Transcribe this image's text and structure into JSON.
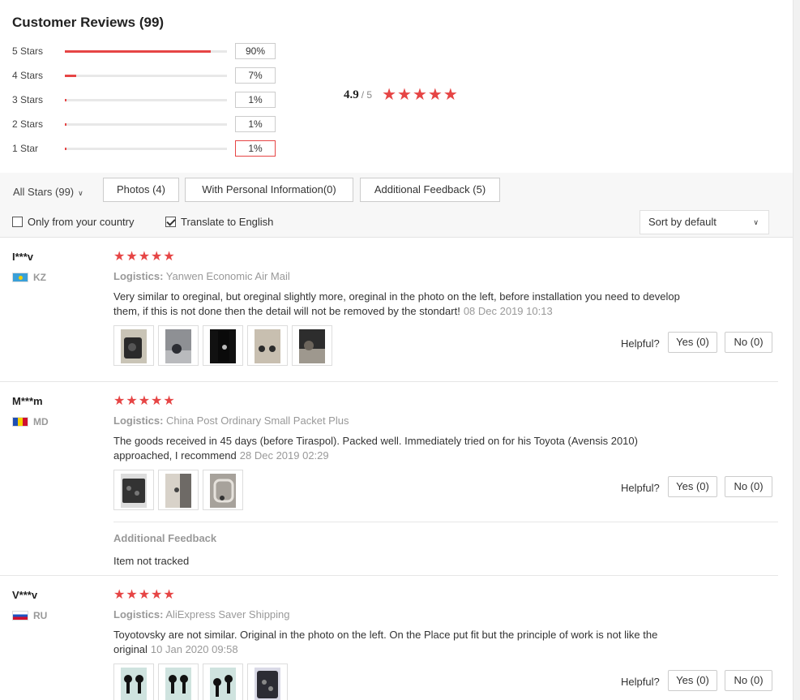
{
  "title": "Customer Reviews (99)",
  "histogram": [
    {
      "label": "5 Stars",
      "percent": "90%",
      "fraction": 0.9
    },
    {
      "label": "4 Stars",
      "percent": "7%",
      "fraction": 0.07
    },
    {
      "label": "3 Stars",
      "percent": "1%",
      "fraction": 0.01
    },
    {
      "label": "2 Stars",
      "percent": "1%",
      "fraction": 0.01
    },
    {
      "label": "1 Star",
      "percent": "1%",
      "fraction": 0.01
    }
  ],
  "average": {
    "score": "4.9",
    "out_of": "/ 5",
    "stars": 5
  },
  "filters": {
    "all_stars": "All Stars (99)",
    "photos": "Photos (4)",
    "personal_info": "With Personal Information(0)",
    "additional_feedback": "Additional Feedback (5)",
    "only_country": "Only from your country",
    "translate": "Translate to English",
    "sort": "Sort by default"
  },
  "helpful_label": "Helpful?",
  "yes_label": "Yes (0)",
  "no_label": "No (0)",
  "logistics_prefix": "Logistics:",
  "reviews": [
    {
      "user": "I***v",
      "country": "KZ",
      "stars": 5,
      "logistics": "Yanwen Economic Air Mail",
      "text": "Very similar to oreginal, but oreginal slightly more, oreginal in the photo on the left, before installation you need to develop them, if this is not done then the detail will not be removed by the stondart!",
      "date": "08 Dec 2019 10:13"
    },
    {
      "user": "M***m",
      "country": "MD",
      "stars": 5,
      "logistics": "China Post Ordinary Small Packet Plus",
      "text": "The goods received in 45 days (before Tiraspol). Packed well. Immediately tried on for his Toyota (Avensis 2010) approached, I recommend",
      "date": "28 Dec 2019 02:29",
      "additional_feedback_title": "Additional Feedback",
      "additional_feedback_text": "Item not tracked"
    },
    {
      "user": "V***v",
      "country": "RU",
      "stars": 5,
      "logistics": "AliExpress Saver Shipping",
      "text": "Toyotovsky are not similar. Original in the photo on the left. On the Place put fit but the principle of work is not like the original",
      "date": "10 Jan 2020 09:58"
    }
  ],
  "colors": {
    "accent": "#e64545",
    "muted": "#999999"
  }
}
